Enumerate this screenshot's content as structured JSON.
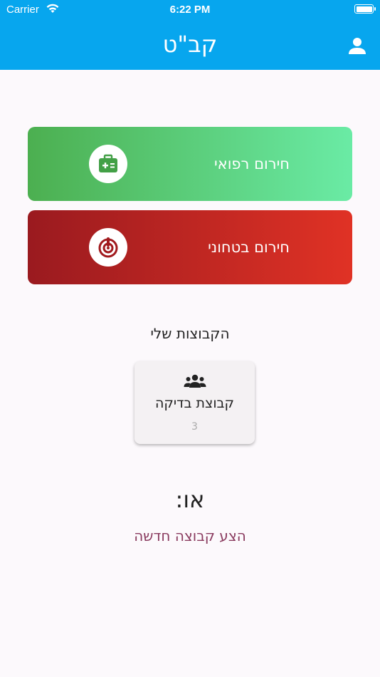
{
  "status_bar": {
    "carrier": "Carrier",
    "time": "6:22 PM"
  },
  "header": {
    "title": "קב\"ט",
    "profile_icon": "person-icon"
  },
  "emergency": {
    "medical": {
      "label": "חירום רפואי",
      "icon": "first-aid-kit-icon",
      "colors": [
        "#4caf50",
        "#6aeba5"
      ]
    },
    "security": {
      "label": "חירום בטחוני",
      "icon": "alarm-icon",
      "colors": [
        "#9a1a1f",
        "#e03225"
      ]
    }
  },
  "groups": {
    "title": "הקבוצות שלי",
    "items": [
      {
        "name": "קבוצת בדיקה",
        "count": "3",
        "icon": "group-icon"
      }
    ]
  },
  "or_label": "או:",
  "suggest_new_group": "הצע קבוצה חדשה",
  "colors": {
    "header": "#07a6ee",
    "link": "#8a3b5f"
  }
}
